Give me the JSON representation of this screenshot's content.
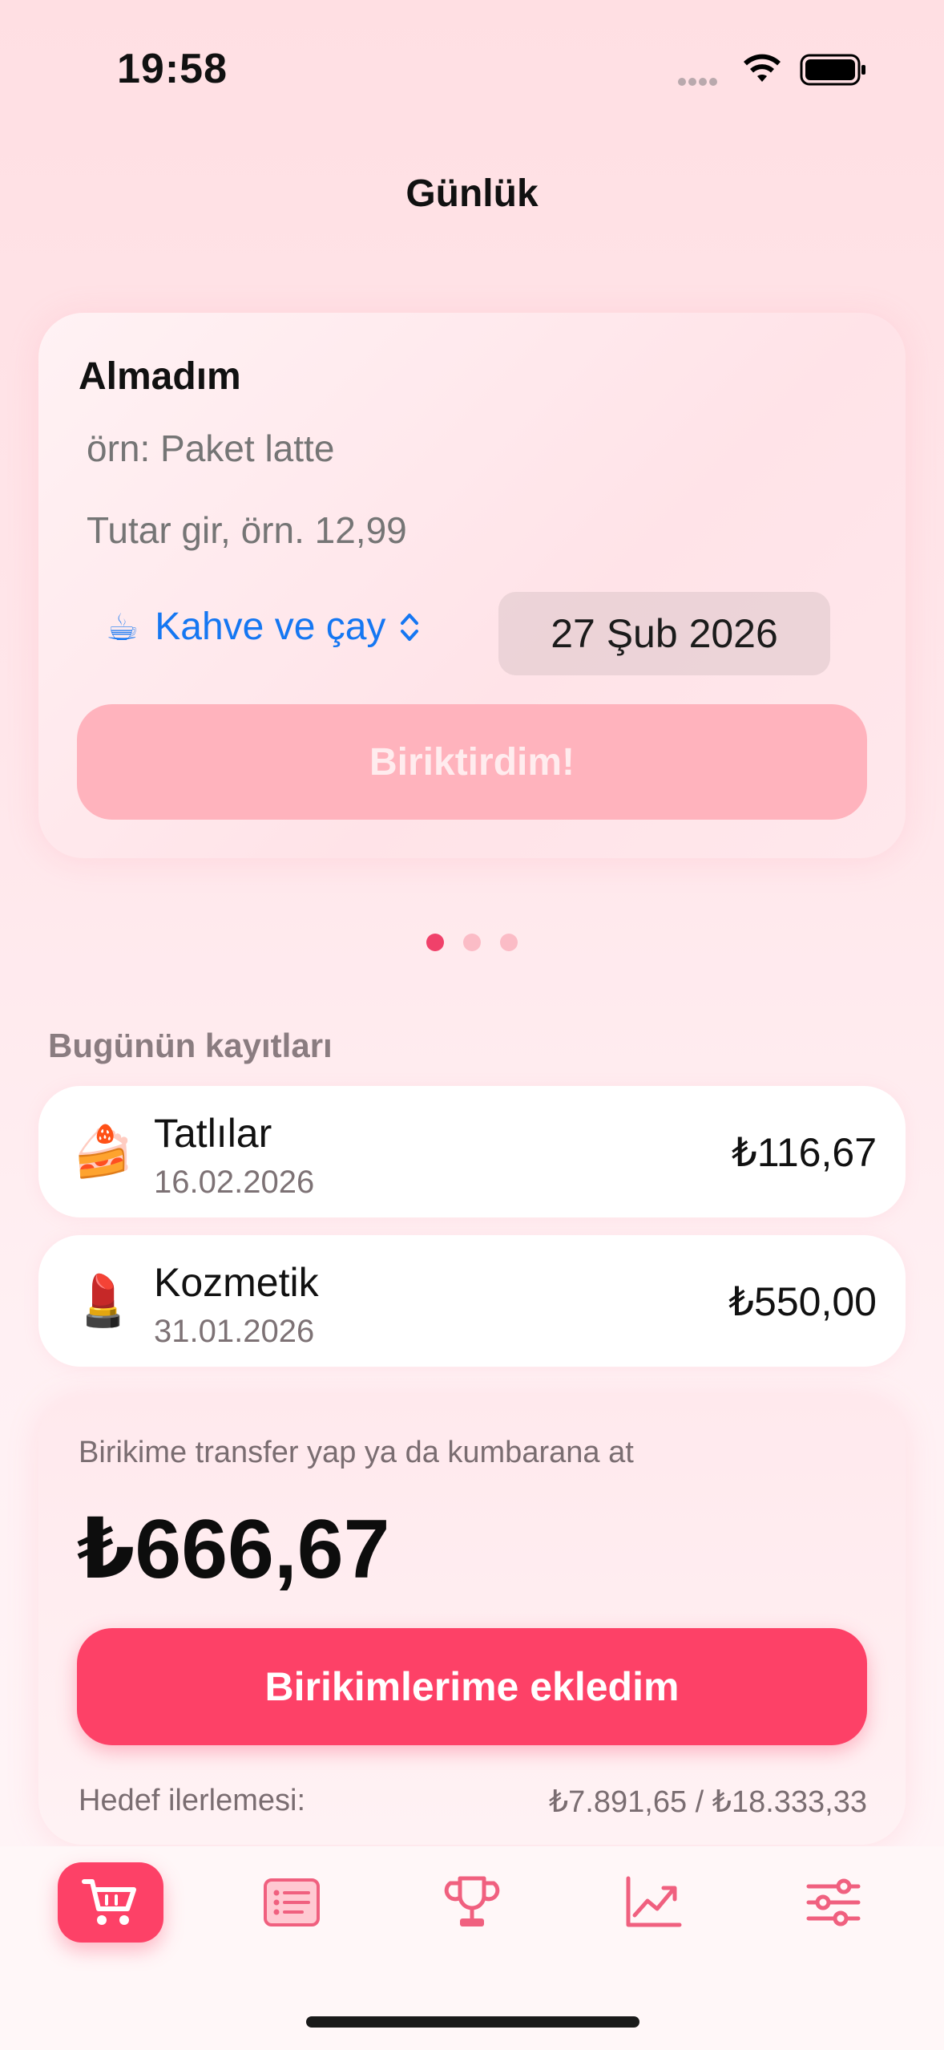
{
  "status_bar": {
    "time": "19:58"
  },
  "page_title": "Günlük",
  "entry": {
    "heading": "Almadım",
    "name_placeholder": "örn: Paket latte",
    "amount_placeholder": "Tutar gir, örn. 12,99",
    "category": {
      "emoji": "☕",
      "label": "Kahve ve çay"
    },
    "date": "27 Şub 2026",
    "save_label": "Biriktirdim!"
  },
  "pager": {
    "pages": 3,
    "active": 0
  },
  "today": {
    "title": "Bugünün kayıtları",
    "items": [
      {
        "emoji": "🍰",
        "title": "Tatlılar",
        "date": "16.02.2026",
        "amount": "₺116,67"
      },
      {
        "emoji": "💄",
        "title": "Kozmetik",
        "date": "31.01.2026",
        "amount": "₺550,00"
      }
    ]
  },
  "summary": {
    "caption": "Birikime transfer yap ya da kumbarana at",
    "total": "₺666,67",
    "button_label": "Birikimlerime ekledim",
    "progress_label": "Hedef ilerlemesi:",
    "progress_value": "₺7.891,65 / ₺18.333,33"
  },
  "tabbar": {
    "items": [
      {
        "icon": "cart-icon",
        "active": true
      },
      {
        "icon": "list-icon",
        "active": false
      },
      {
        "icon": "trophy-icon",
        "active": false
      },
      {
        "icon": "chart-icon",
        "active": false
      },
      {
        "icon": "sliders-icon",
        "active": false
      }
    ]
  },
  "colors": {
    "accent": "#fd4167",
    "link": "#1577f2",
    "disabled_button": "#ffb3bd",
    "icon_inactive": "#f0607f"
  }
}
